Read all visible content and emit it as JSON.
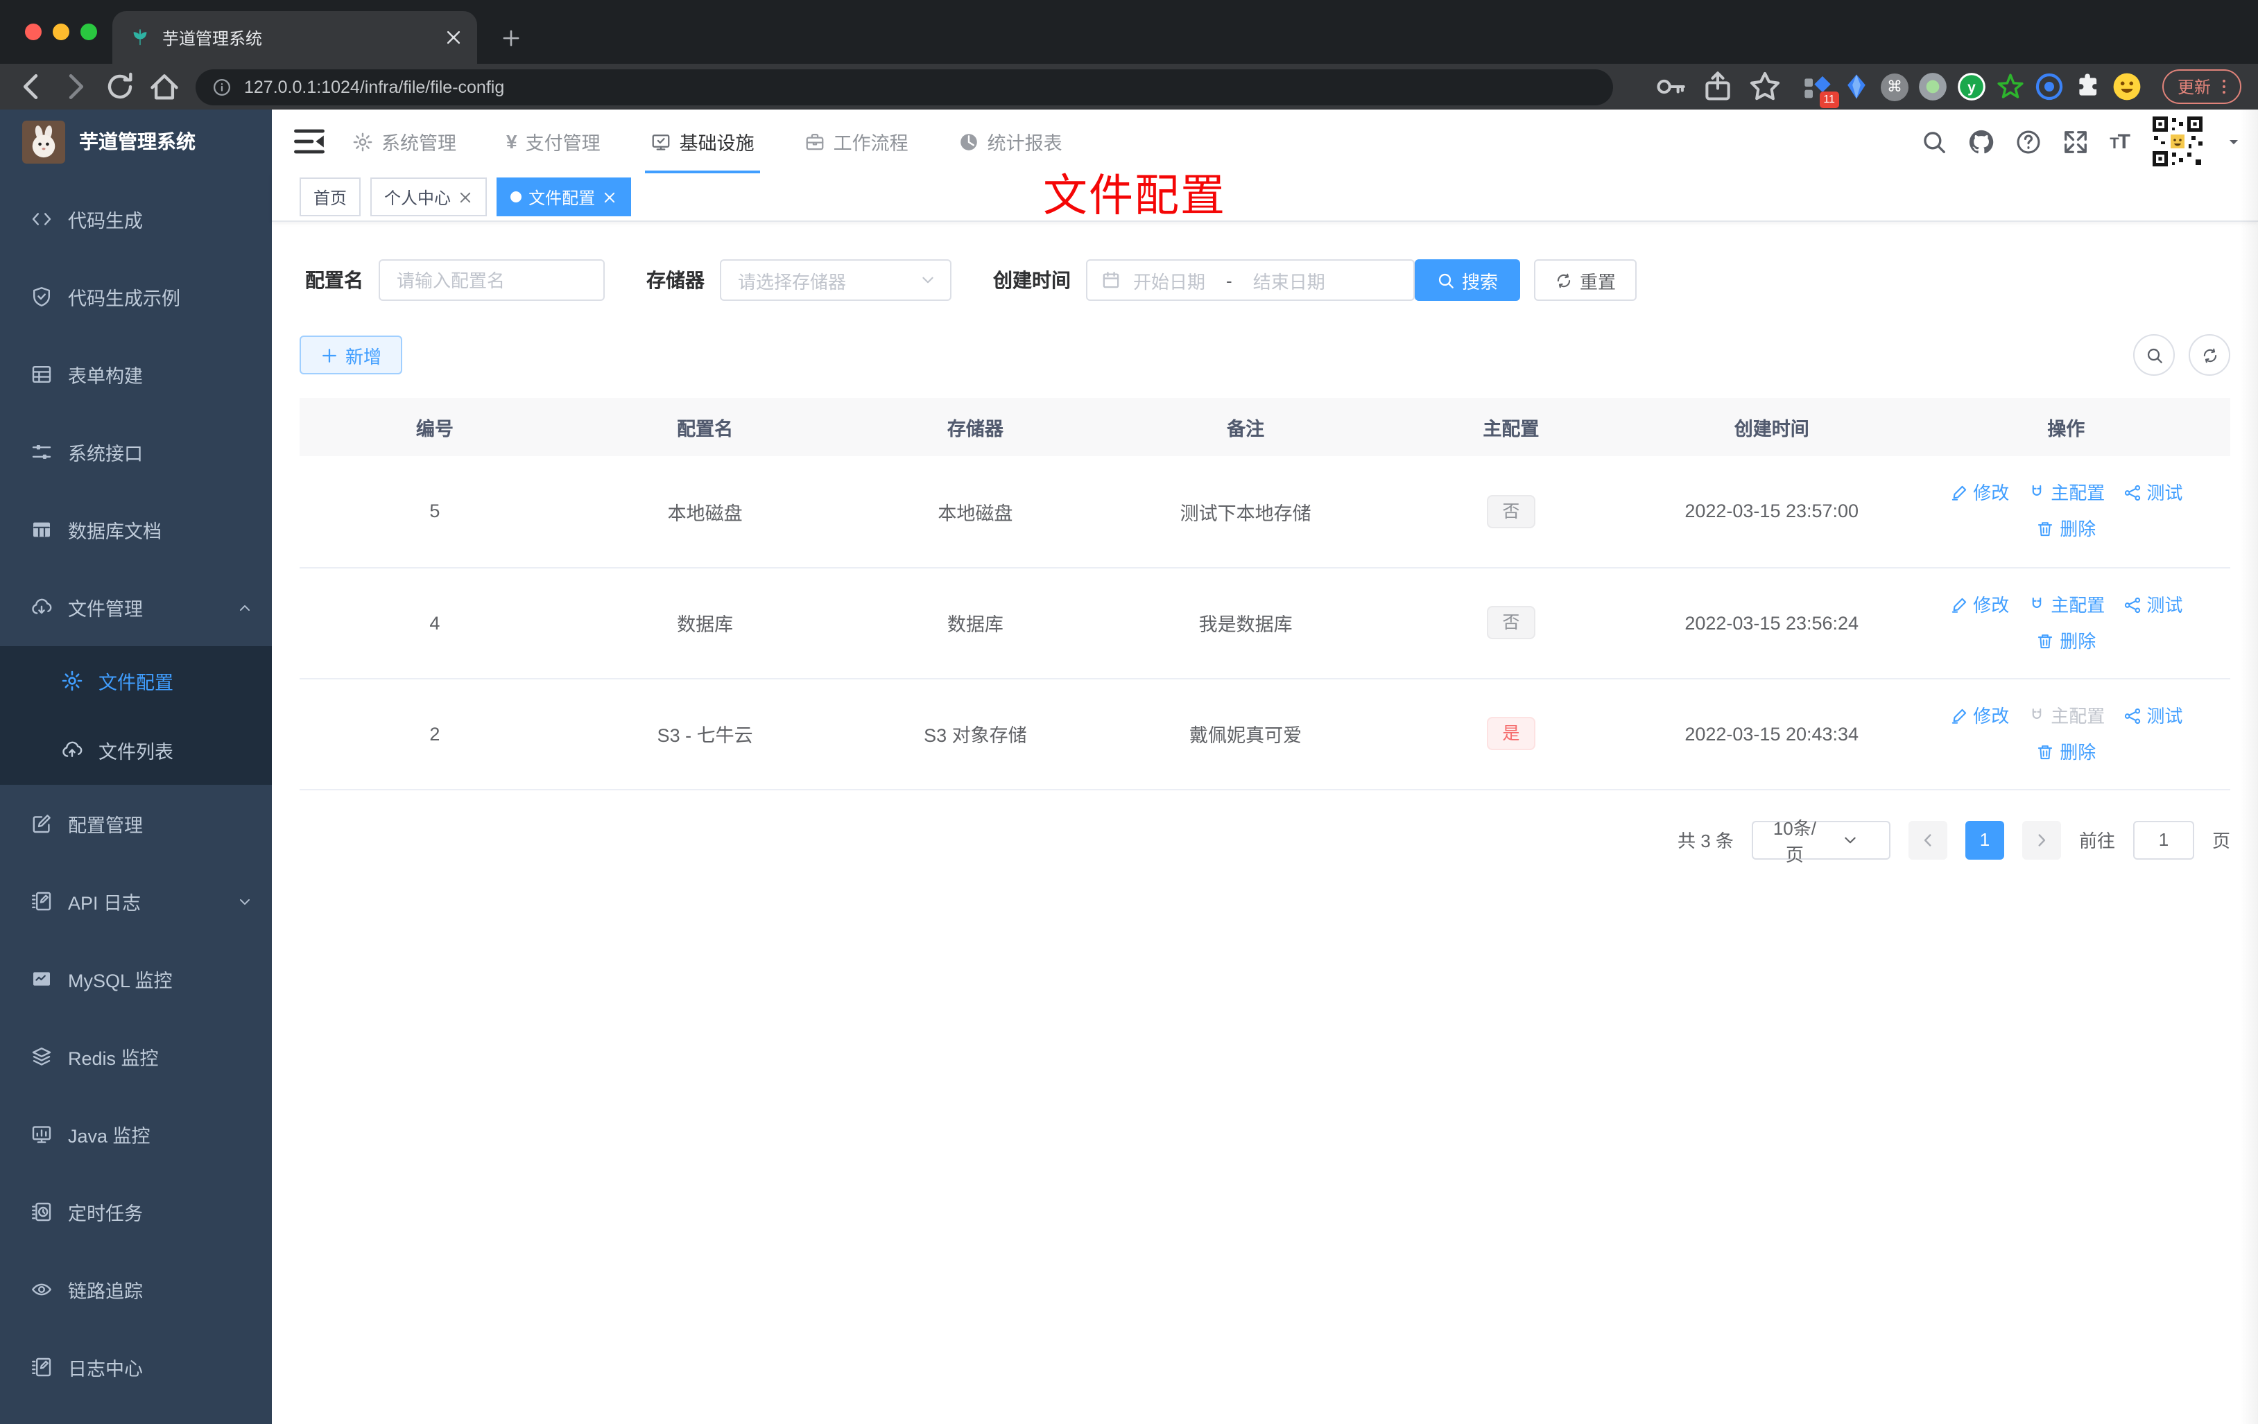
{
  "colors": {
    "accent": "#409eff",
    "danger": "#f56c6c",
    "sidebar_bg": "#304156",
    "submenu_bg": "#1f2d3d",
    "annotation": "#f40606"
  },
  "browser": {
    "tab_title": "芋道管理系统",
    "url": "127.0.0.1:1024/infra/file/file-config",
    "extension_badge": "11",
    "update_label": "更新"
  },
  "sidebar": {
    "title": "芋道管理系统",
    "menu": [
      {
        "icon": "code-icon",
        "label": "代码生成"
      },
      {
        "icon": "shield-check-icon",
        "label": "代码生成示例"
      },
      {
        "icon": "form-grid-icon",
        "label": "表单构建"
      },
      {
        "icon": "sliders-icon",
        "label": "系统接口"
      },
      {
        "icon": "database-table-icon",
        "label": "数据库文档"
      },
      {
        "icon": "cloud-download-icon",
        "label": "文件管理",
        "chevron": "up",
        "children": [
          {
            "icon": "gear-icon",
            "label": "文件配置",
            "active": true
          },
          {
            "icon": "cloud-upload-icon",
            "label": "文件列表"
          }
        ]
      },
      {
        "icon": "edit-square-icon",
        "label": "配置管理"
      },
      {
        "icon": "api-log-icon",
        "label": "API 日志",
        "chevron": "down"
      },
      {
        "icon": "mysql-monitor-icon",
        "label": "MySQL 监控"
      },
      {
        "icon": "redis-layers-icon",
        "label": "Redis 监控"
      },
      {
        "icon": "java-monitor-icon",
        "label": "Java 监控"
      },
      {
        "icon": "timer-task-icon",
        "label": "定时任务"
      },
      {
        "icon": "trace-eye-icon",
        "label": "链路追踪"
      },
      {
        "icon": "log-center-icon",
        "label": "日志中心"
      }
    ]
  },
  "topnav": {
    "active_index": 2,
    "items": [
      {
        "icon": "gear-icon",
        "label": "系统管理"
      },
      {
        "icon": "yen-icon",
        "label": "支付管理"
      },
      {
        "icon": "infra-icon",
        "label": "基础设施"
      },
      {
        "icon": "workflow-icon",
        "label": "工作流程"
      },
      {
        "icon": "report-icon",
        "label": "统计报表"
      }
    ]
  },
  "tags": [
    {
      "label": "首页",
      "closable": false,
      "active": false
    },
    {
      "label": "个人中心",
      "closable": true,
      "active": false
    },
    {
      "label": "文件配置",
      "closable": true,
      "active": true
    }
  ],
  "annotation": {
    "text": "文件配置"
  },
  "filters": {
    "name_label": "配置名",
    "name_placeholder": "请输入配置名",
    "storage_label": "存储器",
    "storage_placeholder": "请选择存储器",
    "time_label": "创建时间",
    "start_placeholder": "开始日期",
    "range_separator": "-",
    "end_placeholder": "结束日期",
    "search_label": "搜索",
    "reset_label": "重置"
  },
  "toolbar": {
    "add_label": "新增"
  },
  "table": {
    "headers": [
      "编号",
      "配置名",
      "存储器",
      "备注",
      "主配置",
      "创建时间",
      "操作"
    ],
    "rows": [
      {
        "id": "5",
        "name": "本地磁盘",
        "storage": "本地磁盘",
        "remark": "测试下本地存储",
        "master": "否",
        "master_type": "info",
        "master_disabled": false,
        "created": "2022-03-15 23:57:00"
      },
      {
        "id": "4",
        "name": "数据库",
        "storage": "数据库",
        "remark": "我是数据库",
        "master": "否",
        "master_type": "info",
        "master_disabled": false,
        "created": "2022-03-15 23:56:24"
      },
      {
        "id": "2",
        "name": "S3 - 七牛云",
        "storage": "S3 对象存储",
        "remark": "戴佩妮真可爱",
        "master": "是",
        "master_type": "danger",
        "master_disabled": true,
        "created": "2022-03-15 20:43:34"
      }
    ]
  },
  "actions": {
    "edit": "修改",
    "master": "主配置",
    "test": "测试",
    "delete": "删除"
  },
  "pagination": {
    "total": "共 3 条",
    "size": "10条/页",
    "page": "1",
    "goto_label": "前往",
    "goto_value": "1",
    "suffix": "页"
  }
}
